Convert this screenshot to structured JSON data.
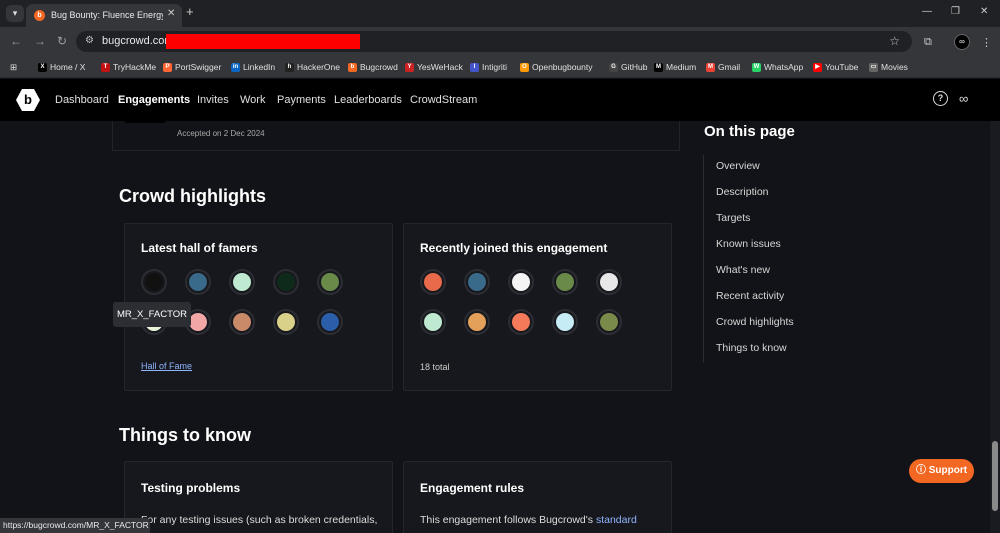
{
  "browser": {
    "tab_title": "Bug Bounty: Fluence Energy Co",
    "tab_favicon": "b",
    "url": "bugcrowd.com/",
    "bookmarks": [
      {
        "label": "Home / X",
        "color": "#000000",
        "glyph": "X"
      },
      {
        "label": "TryHackMe",
        "color": "#c11111",
        "glyph": "T"
      },
      {
        "label": "PortSwigger",
        "color": "#ff6633",
        "glyph": "P"
      },
      {
        "label": "LinkedIn",
        "color": "#0a66c2",
        "glyph": "in"
      },
      {
        "label": "HackerOne",
        "color": "#222222",
        "glyph": "h"
      },
      {
        "label": "Bugcrowd",
        "color": "#f26822",
        "glyph": "b"
      },
      {
        "label": "YesWeHack",
        "color": "#cc2222",
        "glyph": "Y"
      },
      {
        "label": "Intigriti",
        "color": "#4455cc",
        "glyph": "I"
      },
      {
        "label": "Openbugbounty",
        "color": "#ff9900",
        "glyph": "O"
      },
      {
        "label": "GitHub",
        "color": "#444444",
        "glyph": "G"
      },
      {
        "label": "Medium",
        "color": "#000000",
        "glyph": "M"
      },
      {
        "label": "Gmail",
        "color": "#ea4335",
        "glyph": "M"
      },
      {
        "label": "WhatsApp",
        "color": "#25d366",
        "glyph": "W"
      },
      {
        "label": "YouTube",
        "color": "#ff0000",
        "glyph": "▶"
      },
      {
        "label": "Movies",
        "color": "#666666",
        "glyph": "▭"
      }
    ],
    "status_url": "https://bugcrowd.com/MR_X_FACTOR"
  },
  "header": {
    "nav": [
      "Dashboard",
      "Engagements",
      "Invites",
      "Work",
      "Payments",
      "Leaderboards",
      "CrowdStream"
    ],
    "active": "Engagements"
  },
  "content": {
    "accepted_text": "Accepted on 2 Dec 2024",
    "crowd_highlights_title": "Crowd highlights",
    "hall_of_famers": {
      "title": "Latest hall of famers",
      "link": "Hall of Fame",
      "avatar_colors": [
        "#111111",
        "#3a6a8a",
        "#bfe9d0",
        "#0e2a1a",
        "#6a8a4a",
        "#e8f5d8",
        "#f3a6a6",
        "#c98a6a",
        "#d9d08a",
        "#2a5ea8"
      ]
    },
    "recently_joined": {
      "title": "Recently joined this engagement",
      "total": "18 total",
      "avatar_colors": [
        "#e86a4a",
        "#3a6a8a",
        "#f4f4f4",
        "#6a8a4a",
        "#e8e8e8",
        "#bfe9d0",
        "#e2a05a",
        "#f57a5a",
        "#c6ecf5",
        "#7a8a4a"
      ]
    },
    "tooltip": "MR_X_FACTOR",
    "things_to_know_title": "Things to know",
    "testing_problems": {
      "title": "Testing problems",
      "text": "For any testing issues (such as broken credentials,"
    },
    "engagement_rules": {
      "title": "Engagement rules",
      "text": "This engagement follows Bugcrowd's",
      "link": "standard"
    }
  },
  "toc": {
    "title": "On this page",
    "items": [
      "Overview",
      "Description",
      "Targets",
      "Known issues",
      "What's new",
      "Recent activity",
      "Crowd highlights",
      "Things to know"
    ]
  },
  "support_label": "Support"
}
